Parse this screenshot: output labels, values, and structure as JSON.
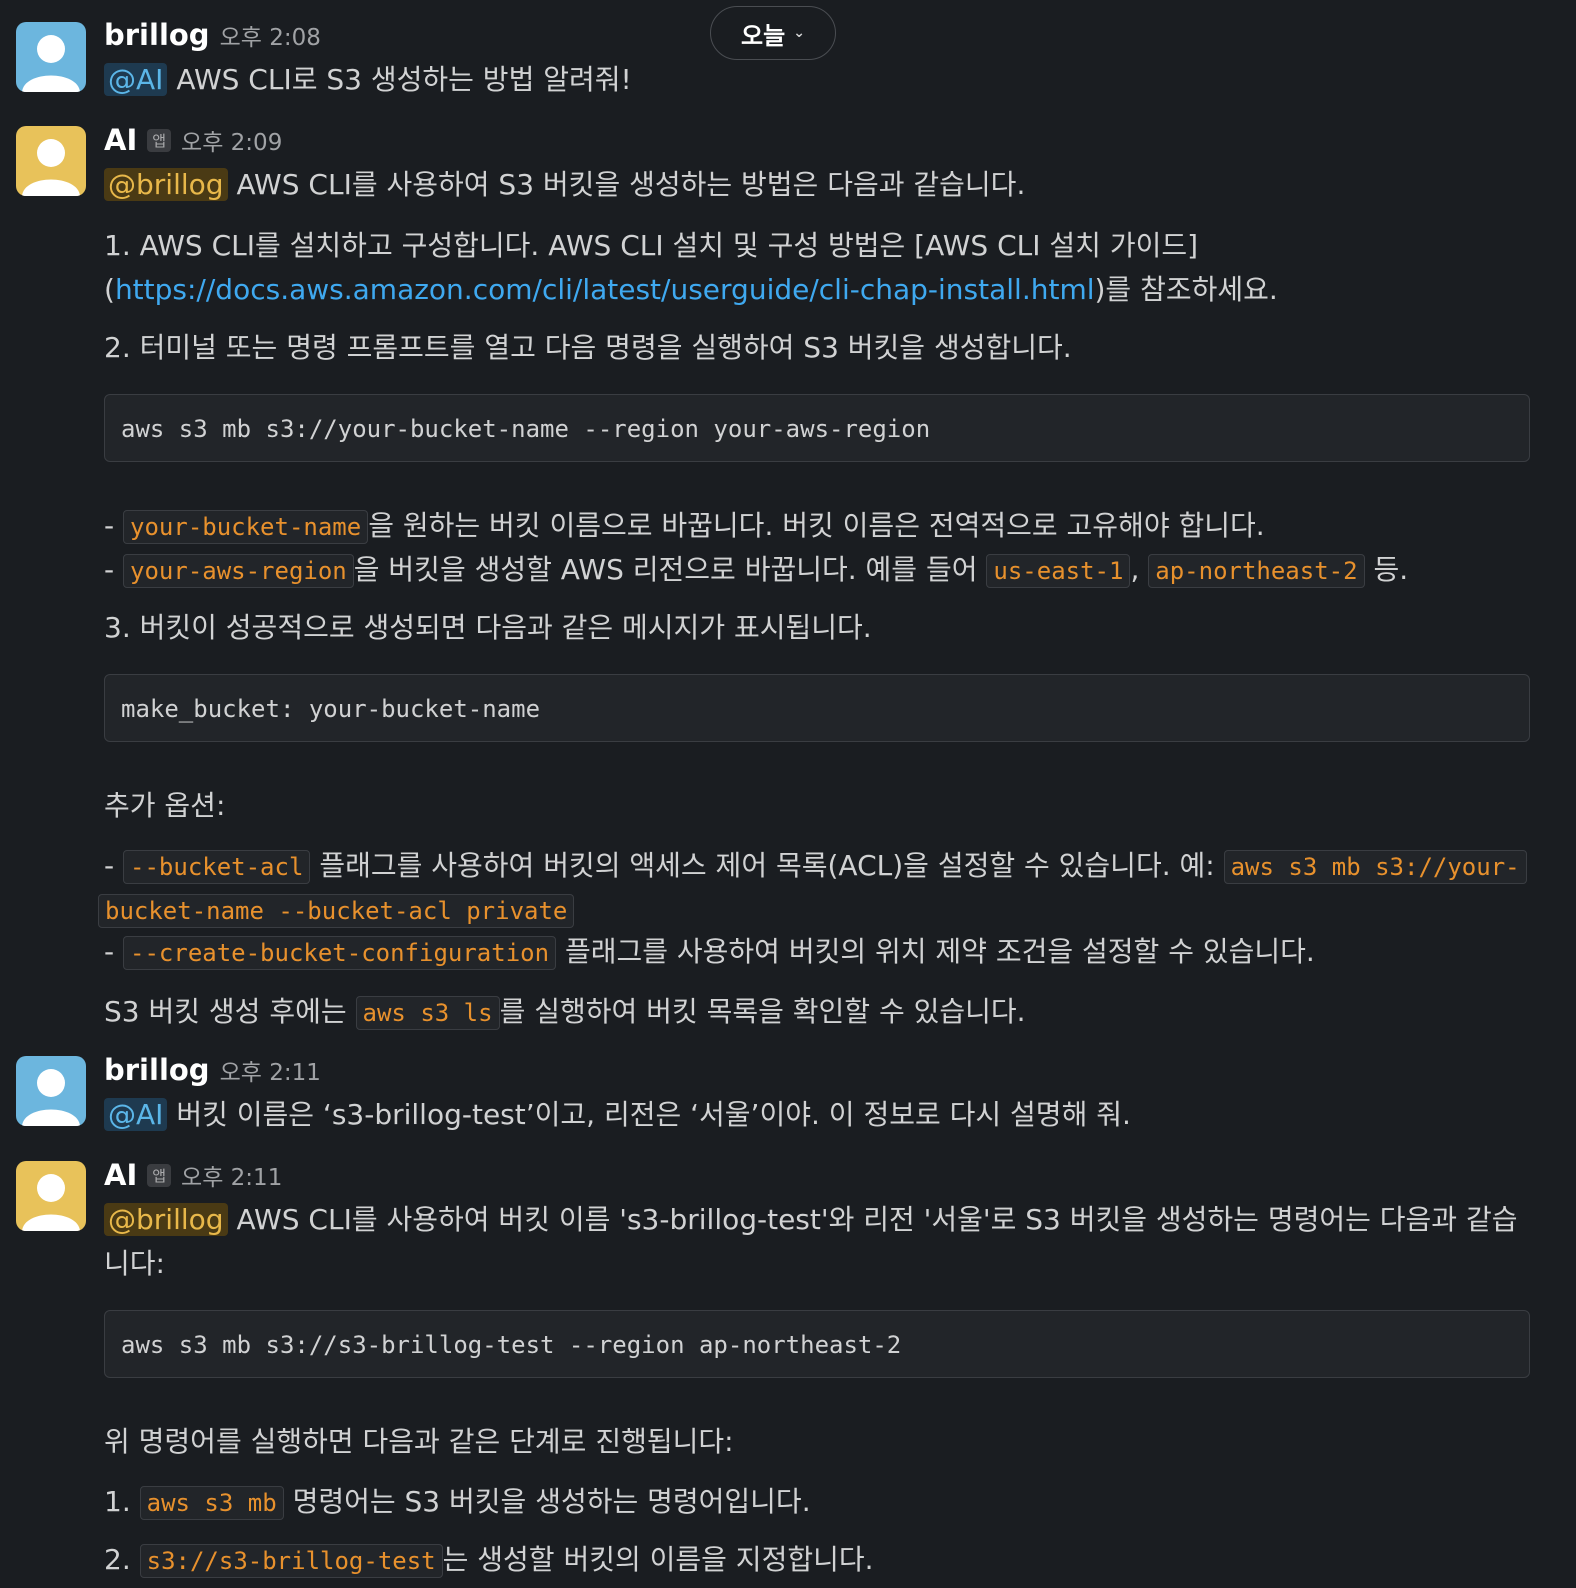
{
  "date_divider": {
    "label": "오늘"
  },
  "messages": [
    {
      "author": "brillog",
      "time": "오후 2:08",
      "mention": "@AI",
      "text": "AWS CLI로 S3 생성하는 방법 알려줘!"
    },
    {
      "author": "AI",
      "app_badge": "앱",
      "time": "오후 2:09",
      "mention": "@brillog",
      "intro": "AWS CLI를 사용하여 S3 버킷을 생성하는 방법은 다음과 같습니다.",
      "step1_a": "1. AWS CLI를 설치하고 구성합니다. AWS CLI 설치 및 구성 방법은 [AWS CLI 설치 가이드]",
      "step1_b_open": "(",
      "step1_link": "https://docs.aws.amazon.com/cli/latest/userguide/cli-chap-install.html",
      "step1_b_close": ")를 참조하세요.",
      "step2": "2. 터미널 또는 명령 프롬프트를 열고 다음 명령을 실행하여 S3 버킷을 생성합니다.",
      "code1": "aws s3 mb s3://your-bucket-name --region your-aws-region",
      "bullet1_dash": "-",
      "bullet1_code": "your-bucket-name",
      "bullet1_text": "을 원하는 버킷 이름으로 바꿉니다. 버킷 이름은 전역적으로 고유해야 합니다.",
      "bullet2_dash": "-",
      "bullet2_code": "your-aws-region",
      "bullet2_text": "을 버킷을 생성할 AWS 리전으로 바꿉니다. 예를 들어",
      "bullet2_ex1": "us-east-1",
      "bullet2_comma": ",",
      "bullet2_ex2": "ap-northeast-2",
      "bullet2_end": "등.",
      "step3": "3. 버킷이 성공적으로 생성되면 다음과 같은 메시지가 표시됩니다.",
      "code2": "make_bucket: your-bucket-name",
      "options_title": "추가 옵션:",
      "opt1_dash": "-",
      "opt1_code": "--bucket-acl",
      "opt1_text": "플래그를 사용하여 버킷의 액세스 제어 목록(ACL)을 설정할 수 있습니다. 예:",
      "opt1_example_a": "aws s3 mb s3://your-",
      "opt1_example_b": "bucket-name --bucket-acl private",
      "opt2_dash": "-",
      "opt2_code": "--create-bucket-configuration",
      "opt2_text": "플래그를 사용하여 버킷의 위치 제약 조건을 설정할 수 있습니다.",
      "outro_a": "S3 버킷 생성 후에는",
      "outro_code": "aws s3 ls",
      "outro_b": "를 실행하여 버킷 목록을 확인할 수 있습니다."
    },
    {
      "author": "brillog",
      "time": "오후 2:11",
      "mention": "@AI",
      "text": "버킷 이름은 ‘s3-brillog-test’이고, 리전은 ‘서울’이야. 이 정보로 다시 설명해 줘."
    },
    {
      "author": "AI",
      "app_badge": "앱",
      "time": "오후 2:11",
      "mention": "@brillog",
      "intro_a": "AWS CLI를 사용하여 버킷 이름 's3-brillog-test'와 리전 '서울'로 S3 버킷을 생성하는 명령어는 다음과 같습",
      "intro_b": "니다:",
      "code": "aws s3 mb s3://s3-brillog-test --region ap-northeast-2",
      "steps_intro": "위 명령어를 실행하면 다음과 같은 단계로 진행됩니다:",
      "s1_num": "1.",
      "s1_code": "aws s3 mb",
      "s1_text": "명령어는 S3 버킷을 생성하는 명령어입니다.",
      "s2_num": "2.",
      "s2_code": "s3://s3-brillog-test",
      "s2_text": "는 생성할 버킷의 이름을 지정합니다."
    }
  ],
  "colors": {
    "background": "#1a1d21",
    "text": "#d1d2d3",
    "link": "#3fa9f0",
    "inline_code": "#e8912d",
    "mention_ai": "#5bb6e8",
    "mention_user": "#e8b84a",
    "avatar_user": "#6cb6de",
    "avatar_app": "#e8c25a"
  },
  "icons": {
    "avatar_user": "default-person-avatar-blue",
    "avatar_app": "default-person-avatar-yellow",
    "date_chevron": "chevron-down-icon"
  }
}
